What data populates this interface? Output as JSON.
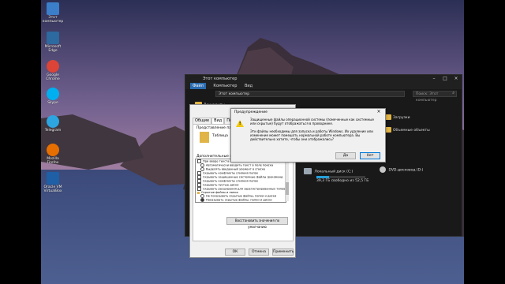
{
  "desktop": {
    "icons": [
      {
        "label": "Этот\nкомпьютер",
        "color": "#3b7ec9"
      },
      {
        "label": "Microsoft\nEdge",
        "color": "#2d6a9f"
      },
      {
        "label": "Google\nChrome",
        "color": "#db4437"
      },
      {
        "label": "Skype",
        "color": "#00aff0"
      },
      {
        "label": "Telegram",
        "color": "#2ca5e0"
      },
      {
        "label": "Mozilla\nFirefox",
        "color": "#e76f00"
      },
      {
        "label": "Oracle VM\nVirtualBox",
        "color": "#1f5fa5"
      }
    ]
  },
  "explorer": {
    "title": "Этот компьютер",
    "ribbon_tabs": [
      "Файл",
      "Компьютер",
      "Вид"
    ],
    "address": "Этот компьютер",
    "search_placeholder": "Поиск: Этот компьютер",
    "folders_left": [
      "Документы"
    ],
    "folders_right": [
      "Загрузки",
      "Объемные объекты"
    ],
    "drive_c_label": "Локальный диск (C:)",
    "drive_c_free": "39,3 ГБ свободно из 52,5 ГБ",
    "drive_c_used_fraction": 0.25,
    "drive_d_label": "DVD-дисковод (D:)"
  },
  "folder_options": {
    "tabs": [
      "Общие",
      "Вид",
      "Поиск"
    ],
    "section_title": "Представление папок",
    "view_hint": "Таблица",
    "advanced_label": "Дополнительные параметры:",
    "list_items": [
      {
        "type": "cb",
        "text": "При вводе текста в режиме \"Список\""
      },
      {
        "type": "rb",
        "text": "Автоматически вводить текст в поле поиска"
      },
      {
        "type": "rb",
        "text": "Выделять введенный элемент в списке"
      },
      {
        "type": "cb",
        "text": "Скрывать конфликты слияния папок"
      },
      {
        "type": "cb",
        "text": "Скрывать защищенные системные файлы (рекоменд"
      },
      {
        "type": "cb",
        "text": "Скрывать конфликты слияния папок"
      },
      {
        "type": "cb",
        "text": "Скрывать пустые диски"
      },
      {
        "type": "cb",
        "text": "Скрывать расширения для зарегистрированных типов"
      },
      {
        "type": "cb",
        "text": "Скрытые файлы и папки"
      },
      {
        "type": "rb",
        "text": "Не показывать скрытые файлы, папки и диски"
      },
      {
        "type": "rb",
        "text": "Показывать скрытые файлы, папки и диски"
      }
    ],
    "restore_defaults": "Восстановить значения по умолчанию",
    "ok": "ОК",
    "cancel": "Отмена",
    "apply": "Применить"
  },
  "warning": {
    "title": "Предупреждение",
    "paragraph1": "Защищенные файлы операционной системы (помеченные как системные или скрытые) будут отображаться в проводнике.",
    "paragraph2": "Эти файлы необходимы для запуска и работы Windows. Их удаление или изменение может помешать нормальной работе компьютера. Вы действительно хотите, чтобы они отображались?",
    "yes": "Да",
    "no": "Нет",
    "icon": "warning-icon"
  }
}
